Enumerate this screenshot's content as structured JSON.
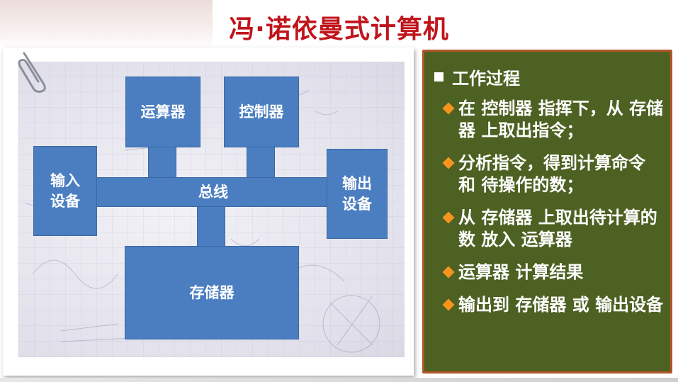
{
  "title": "冯·诺依曼式计算机",
  "diagram": {
    "blocks": {
      "alu": "运算器",
      "controller": "控制器",
      "input": "输入\n设备",
      "bus": "总线",
      "output": "输出\n设备",
      "memory": "存储器"
    }
  },
  "panel": {
    "heading": "工作过程",
    "items": [
      "在 控制器 指挥下，从 存储器 上取出指令；",
      "分析指令，得到计算命令 和 待操作的数；",
      "从 存储器 上取出待计算的数 放入 运算器",
      "运算器 计算结果",
      "输出到 存储器 或 输出设备"
    ]
  },
  "colors": {
    "title": "#c0141b",
    "block": "#4a7ec0",
    "panel_bg": "#4d6122",
    "panel_border": "#b35627",
    "bullet": "#f7941d"
  }
}
